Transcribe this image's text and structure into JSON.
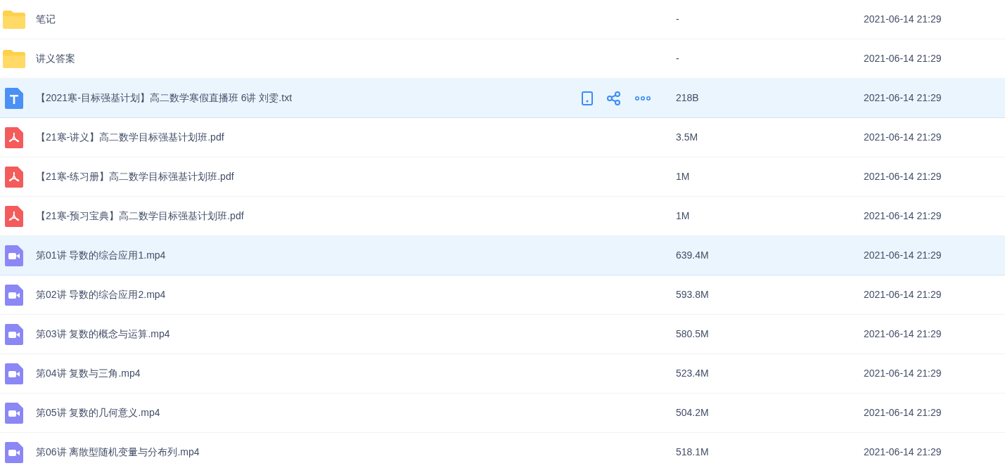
{
  "files": [
    {
      "kind": "folder",
      "name": "笔记",
      "size": "-",
      "date": "2021-06-14 21:29",
      "highlighted": false
    },
    {
      "kind": "folder",
      "name": "讲义答案",
      "size": "-",
      "date": "2021-06-14 21:29",
      "highlighted": false
    },
    {
      "kind": "txt",
      "name": "【2021寒-目标强基计划】高二数学寒假直播班 6讲 刘雯.txt",
      "size": "218B",
      "date": "2021-06-14 21:29",
      "highlighted": true,
      "actions_shown": true
    },
    {
      "kind": "pdf",
      "name": "【21寒-讲义】高二数学目标强基计划班.pdf",
      "size": "3.5M",
      "date": "2021-06-14 21:29",
      "highlighted": false
    },
    {
      "kind": "pdf",
      "name": "【21寒-练习册】高二数学目标强基计划班.pdf",
      "size": "1M",
      "date": "2021-06-14 21:29",
      "highlighted": false
    },
    {
      "kind": "pdf",
      "name": "【21寒-预习宝典】高二数学目标强基计划班.pdf",
      "size": "1M",
      "date": "2021-06-14 21:29",
      "highlighted": false
    },
    {
      "kind": "video",
      "name": "第01讲 导数的综合应用1.mp4",
      "size": "639.4M",
      "date": "2021-06-14 21:29",
      "highlighted": true
    },
    {
      "kind": "video",
      "name": "第02讲 导数的综合应用2.mp4",
      "size": "593.8M",
      "date": "2021-06-14 21:29",
      "highlighted": false
    },
    {
      "kind": "video",
      "name": "第03讲 复数的概念与运算.mp4",
      "size": "580.5M",
      "date": "2021-06-14 21:29",
      "highlighted": false
    },
    {
      "kind": "video",
      "name": "第04讲 复数与三角.mp4",
      "size": "523.4M",
      "date": "2021-06-14 21:29",
      "highlighted": false
    },
    {
      "kind": "video",
      "name": "第05讲 复数的几何意义.mp4",
      "size": "504.2M",
      "date": "2021-06-14 21:29",
      "highlighted": false
    },
    {
      "kind": "video",
      "name": "第06讲 离散型随机变量与分布列.mp4",
      "size": "518.1M",
      "date": "2021-06-14 21:29",
      "highlighted": false
    }
  ]
}
